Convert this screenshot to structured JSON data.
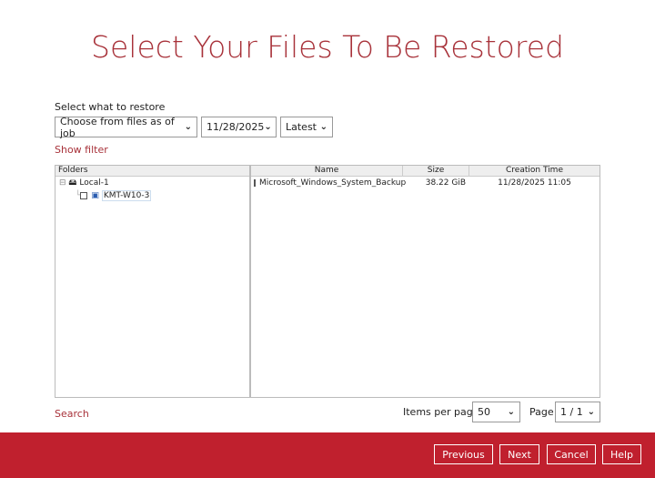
{
  "title": "Select Your Files To Be Restored",
  "restore_label": "Select what to restore",
  "mode": "Choose from files as of job",
  "date": "11/28/2025",
  "version": "Latest",
  "show_filter": "Show filter",
  "tree": {
    "header": "Folders",
    "root": "Local-1",
    "child": "KMT-W10-3"
  },
  "table": {
    "columns": [
      "Name",
      "Size",
      "Creation Time"
    ],
    "rows": [
      {
        "name": "Microsoft_Windows_System_Backup",
        "size": "38.22 GiB",
        "time": "11/28/2025 11:05"
      }
    ]
  },
  "search": "Search",
  "items_per_page_label": "Items per page",
  "items_per_page": "50",
  "page_label": "Page",
  "page": "1 / 1",
  "buttons": {
    "previous": "Previous",
    "next": "Next",
    "cancel": "Cancel",
    "help": "Help"
  }
}
